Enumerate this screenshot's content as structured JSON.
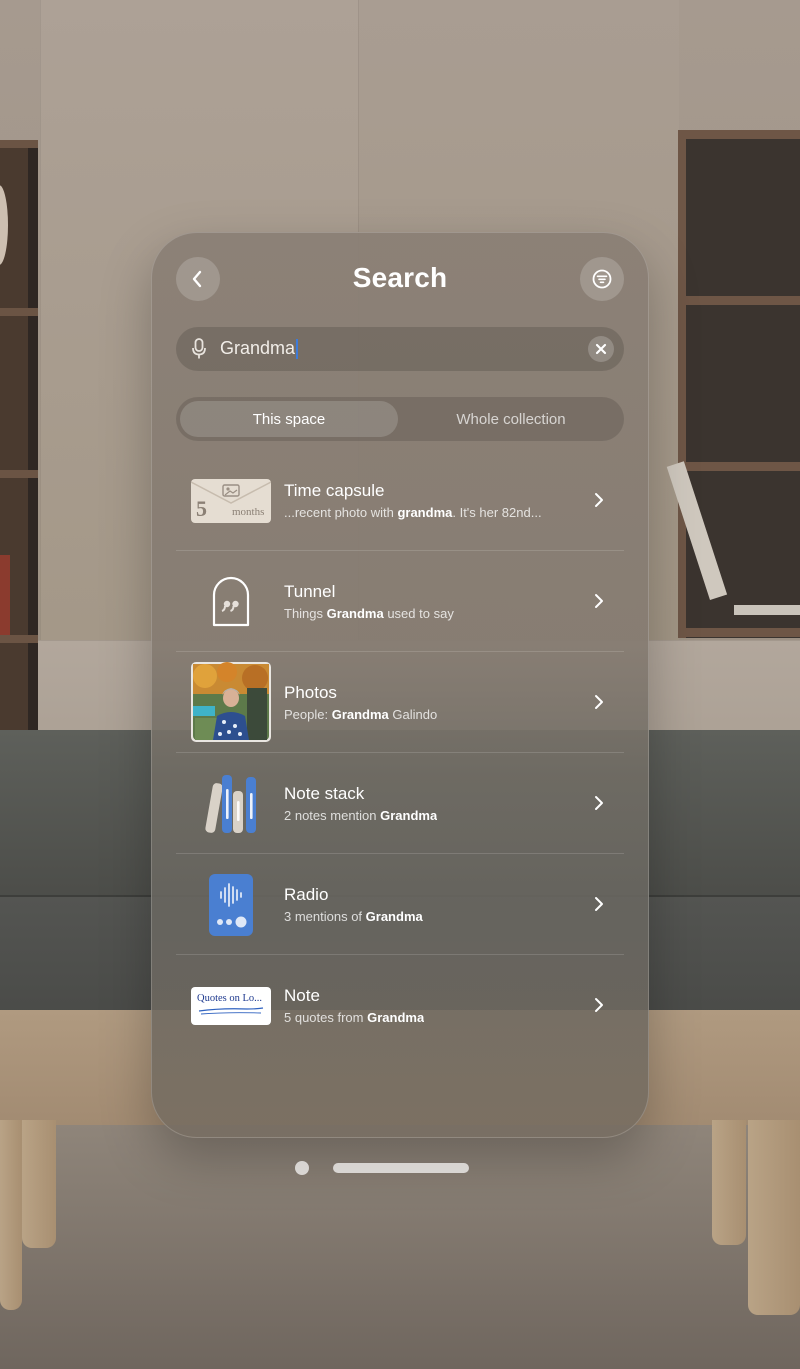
{
  "header": {
    "title": "Search"
  },
  "search": {
    "value": "Grandma"
  },
  "scope": {
    "options": [
      "This space",
      "Whole collection"
    ],
    "selected": "This space"
  },
  "results": [
    {
      "title": "Time capsule",
      "sub_pre": "...recent photo with ",
      "sub_bold": "grandma",
      "sub_post": ". It's her 82nd...",
      "thumb": {
        "type": "envelope",
        "number": "5",
        "unit": "months"
      }
    },
    {
      "title": "Tunnel",
      "sub_pre": "Things ",
      "sub_bold": "Grandma",
      "sub_post": " used to say",
      "thumb": {
        "type": "quote-door",
        "icon": "quote-door-icon"
      }
    },
    {
      "title": "Photos",
      "sub_pre": "People: ",
      "sub_bold": "Grandma",
      "sub_post": " Galindo",
      "thumb": {
        "type": "photo"
      }
    },
    {
      "title": "Note stack",
      "sub_pre": "2 notes mention ",
      "sub_bold": "Grandma",
      "sub_post": "",
      "thumb": {
        "type": "stack",
        "icon": "note-stack-icon"
      }
    },
    {
      "title": "Radio",
      "sub_pre": "3 mentions of ",
      "sub_bold": "Grandma",
      "sub_post": "",
      "thumb": {
        "type": "radio",
        "icon": "radio-icon"
      }
    },
    {
      "title": "Note",
      "sub_pre": "5 quotes from ",
      "sub_bold": "Grandma",
      "sub_post": "",
      "thumb": {
        "type": "note-card",
        "text": "Quotes on Lo..."
      }
    }
  ],
  "icons": [
    "back-chevron-icon",
    "filter-icon",
    "microphone-icon",
    "clear-icon",
    "chevron-right-icon"
  ],
  "colors": {
    "accent": "#3d7bd9",
    "radio_blue": "#4a7fd1"
  }
}
